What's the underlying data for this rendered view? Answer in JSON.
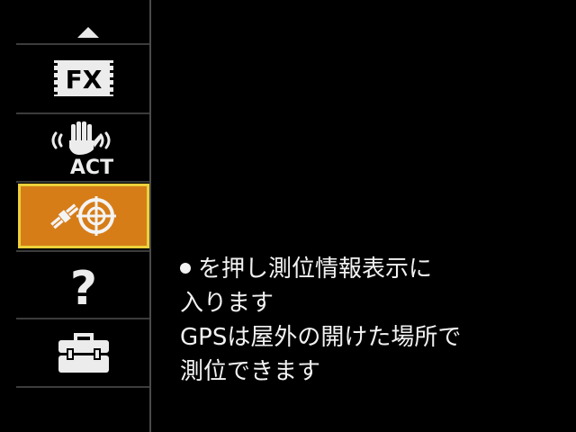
{
  "sidebar": {
    "items": [
      {
        "id": "fx",
        "label": "FX",
        "icon": "fx-filter-icon",
        "selected": false
      },
      {
        "id": "stabilizer",
        "label": "ACT",
        "icon": "image-stabilizer-act-icon",
        "selected": false
      },
      {
        "id": "gps",
        "label": "",
        "icon": "gps-satellite-icon",
        "selected": true
      },
      {
        "id": "help",
        "label": "?",
        "icon": "help-icon",
        "selected": false
      },
      {
        "id": "tools",
        "label": "",
        "icon": "toolbox-icon",
        "selected": false
      }
    ]
  },
  "help": {
    "lines": [
      "を押し測位情報表示に",
      "入ります",
      "GPSは屋外の開けた場所で",
      "測位できます"
    ]
  },
  "colors": {
    "background": "#000000",
    "selection_fill": "#d67d18",
    "selection_border": "#ecd13a",
    "text": "#f2f2f2",
    "divider": "#3c3c3c"
  }
}
